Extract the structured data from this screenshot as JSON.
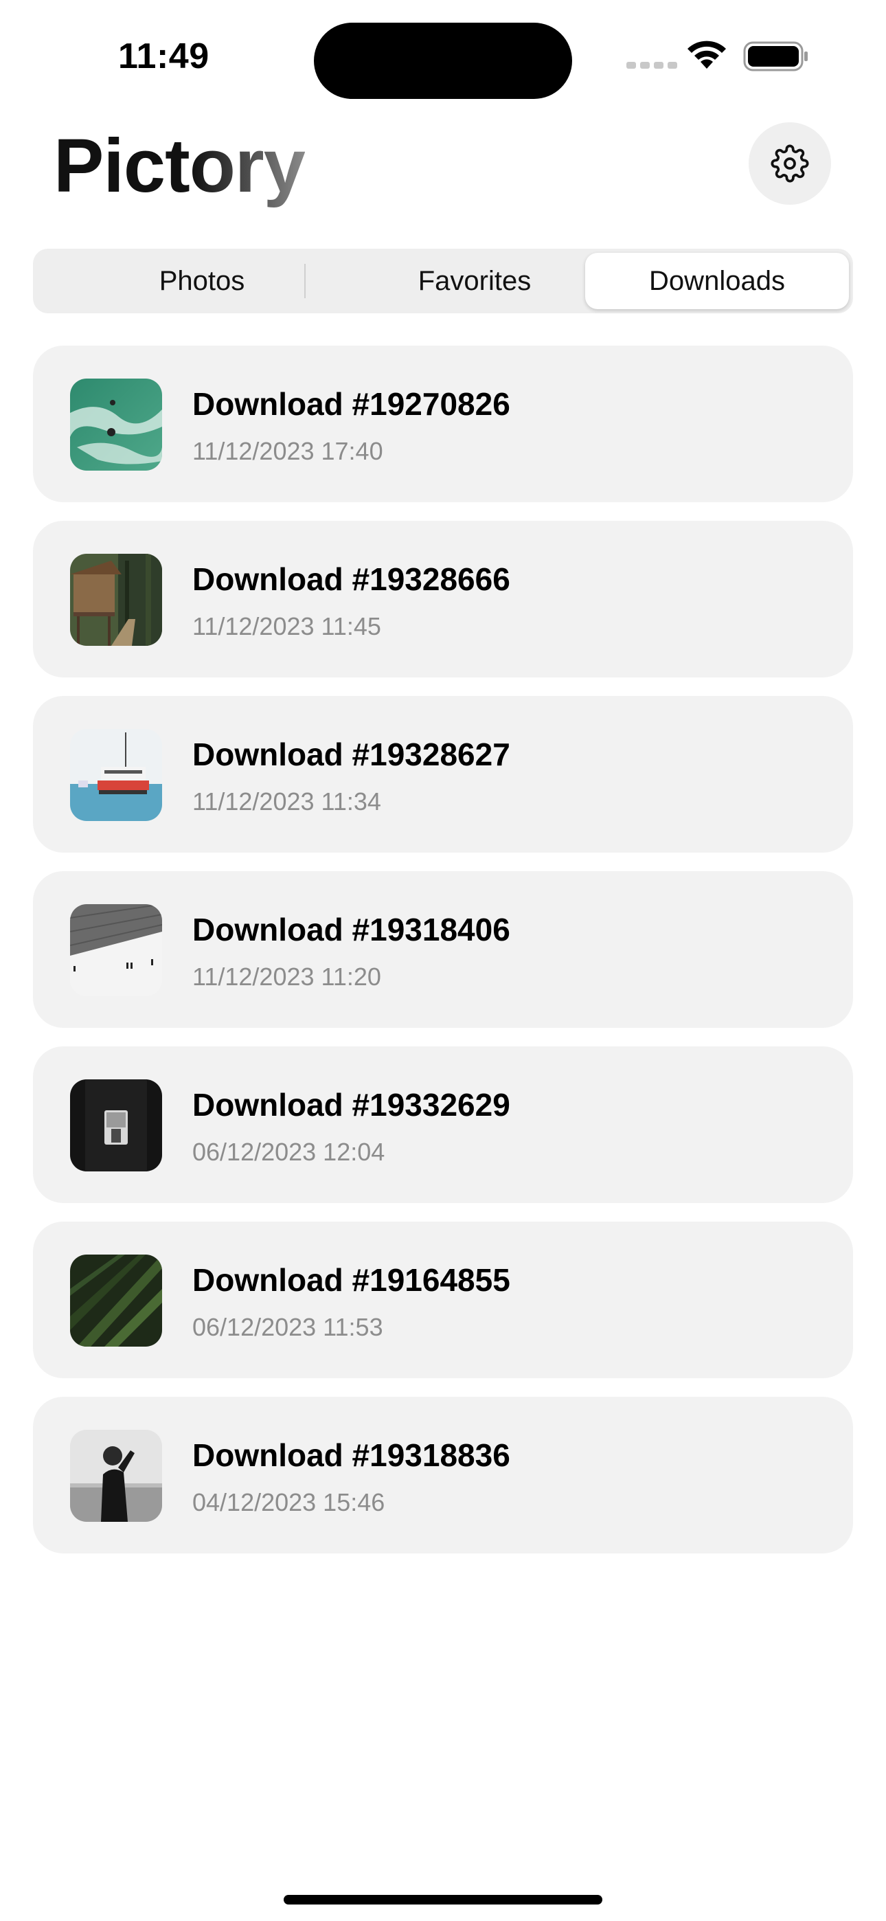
{
  "status_bar": {
    "time": "11:49"
  },
  "header": {
    "title": "Pictory"
  },
  "tabs": [
    {
      "label": "Photos",
      "selected": false
    },
    {
      "label": "Favorites",
      "selected": false
    },
    {
      "label": "Downloads",
      "selected": true
    }
  ],
  "downloads": [
    {
      "title": "Download #19270826",
      "date": "11/12/2023 17:40",
      "thumbnail": "ocean-swimmers"
    },
    {
      "title": "Download #19328666",
      "date": "11/12/2023 11:45",
      "thumbnail": "forest-cabin"
    },
    {
      "title": "Download #19328627",
      "date": "11/12/2023 11:34",
      "thumbnail": "ferry-boat"
    },
    {
      "title": "Download #19318406",
      "date": "11/12/2023 11:20",
      "thumbnail": "snow-slope"
    },
    {
      "title": "Download #19332629",
      "date": "06/12/2023 12:04",
      "thumbnail": "dark-window"
    },
    {
      "title": "Download #19164855",
      "date": "06/12/2023 11:53",
      "thumbnail": "palm-leaves"
    },
    {
      "title": "Download #19318836",
      "date": "04/12/2023 15:46",
      "thumbnail": "beach-portrait"
    }
  ],
  "icons": {
    "settings": "gear-icon",
    "signal": "cellular-signal-icon",
    "wifi": "wifi-icon",
    "battery": "battery-icon"
  },
  "colors": {
    "background": "#ffffff",
    "card": "#f2f2f2",
    "secondary_text": "#8c8c8c"
  }
}
